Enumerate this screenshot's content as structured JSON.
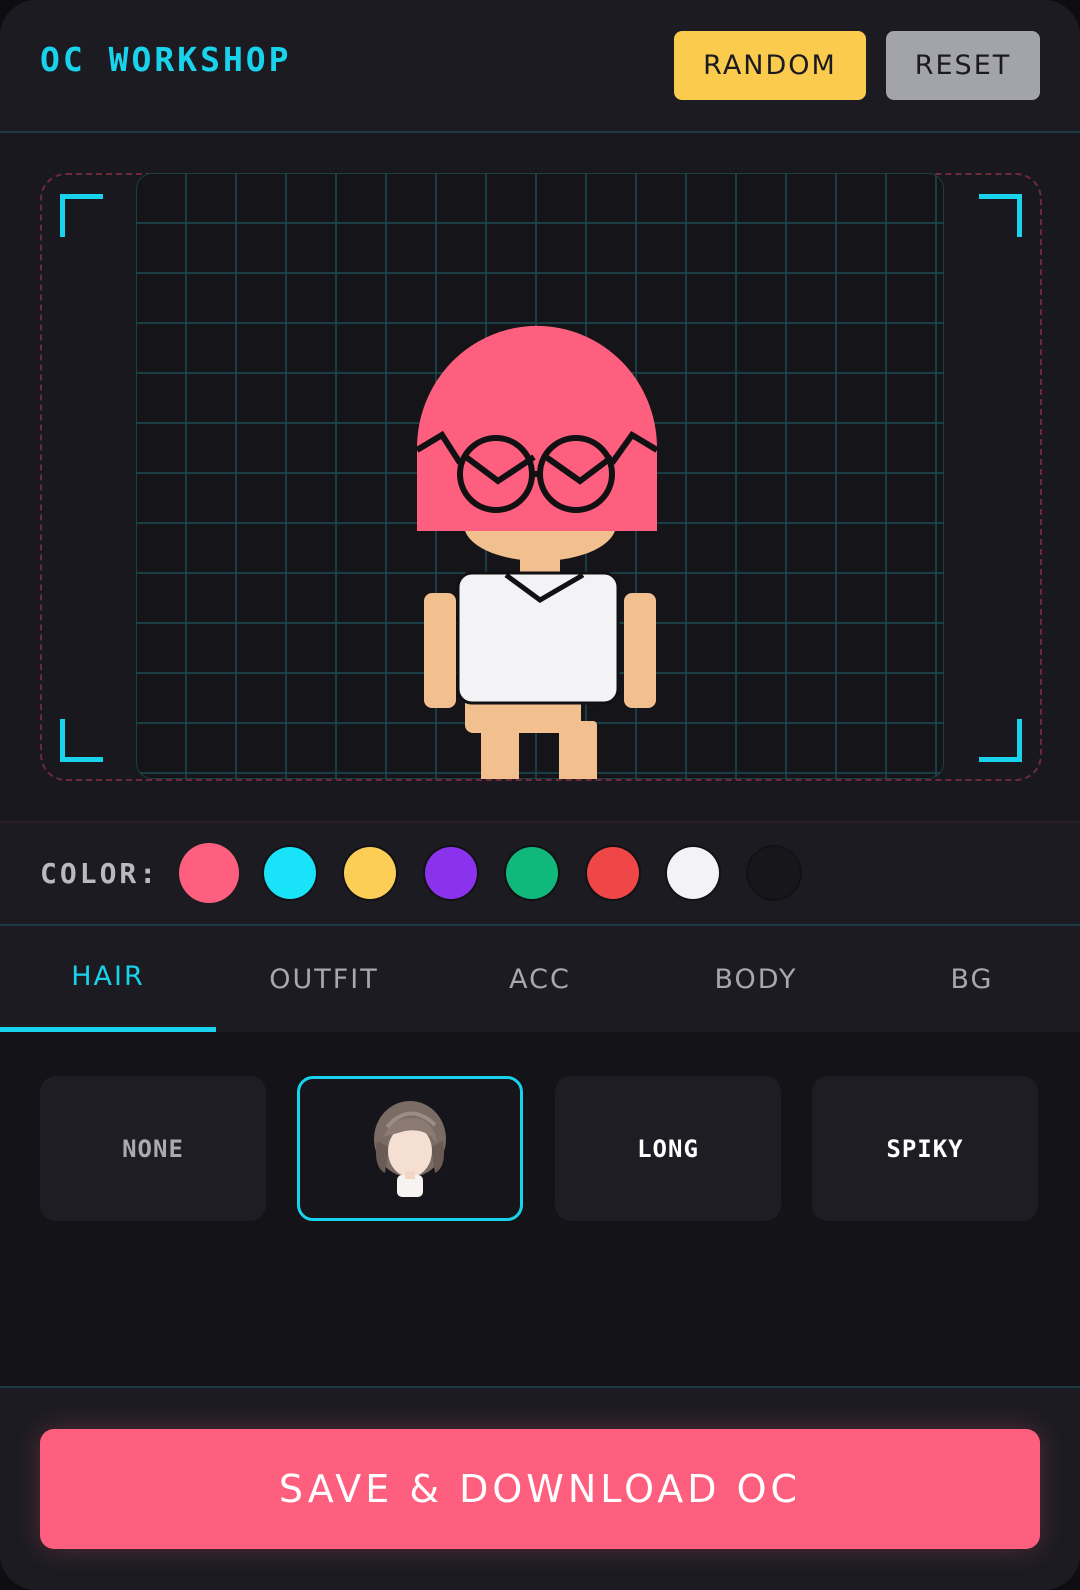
{
  "app": {
    "title": "OC WORKSHOP"
  },
  "header": {
    "random_label": "RANDOM",
    "reset_label": "RESET"
  },
  "colors": {
    "label": "COLOR:",
    "swatches": [
      "#ff5f7e",
      "#18e3f8",
      "#fcce55",
      "#8b32ec",
      "#10b97b",
      "#ef4747",
      "#f3f3f6",
      "#16161b"
    ],
    "selected": "#ff5f7e"
  },
  "tabs": [
    {
      "label": "HAIR",
      "active": true
    },
    {
      "label": "OUTFIT",
      "active": false
    },
    {
      "label": "ACC",
      "active": false
    },
    {
      "label": "BODY",
      "active": false
    },
    {
      "label": "BG",
      "active": false
    }
  ],
  "options": [
    {
      "label": "NONE",
      "selected": false
    },
    {
      "label": "",
      "icon": "hair-thumbnail-icon",
      "selected": true
    },
    {
      "label": "LONG",
      "selected": false
    },
    {
      "label": "SPIKY",
      "selected": false
    }
  ],
  "character": {
    "hair_color": "#ff5f7e",
    "skin_color": "#f2c08f",
    "outfit_color": "#f3f3f6",
    "outline_color": "#111114"
  },
  "footer": {
    "save_label": "SAVE & DOWNLOAD OC"
  },
  "theme": {
    "accent": "#19d3ec",
    "primary": "#ff5f7e",
    "warning": "#fbcb4e"
  }
}
